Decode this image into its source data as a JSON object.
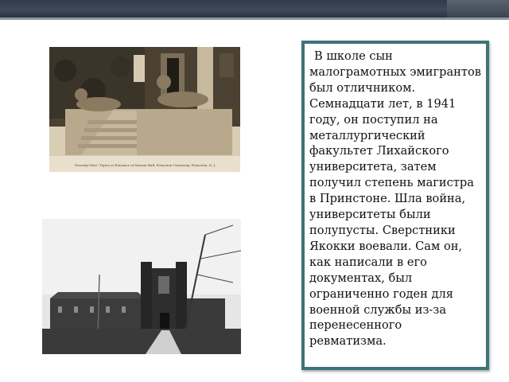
{
  "slide": {
    "header_colors": {
      "bar": "#2f3a48",
      "rule": "#8e979f",
      "panel_border": "#3f7378"
    },
    "photos": [
      {
        "name": "campus-tigers-photo",
        "caption": "\"Seventy-Nine\" Tigers at Entrance of Nassau Hall, Princeton University, Princeton, N. J."
      },
      {
        "name": "campus-tower-photo"
      }
    ],
    "text": "В школе сын малограмотных эмигрантов был отличником. Семнадцати лет, в 1941 году, он поступил на металлургический факультет Лихайского университета, затем получил степень магистра в Принстоне. Шла война, университеты были полупусты. Сверстники Якокки воевали. Сам он, как написали в его документах, был ограниченно годен для военной службы из-за перенесенного ревматизма."
  }
}
